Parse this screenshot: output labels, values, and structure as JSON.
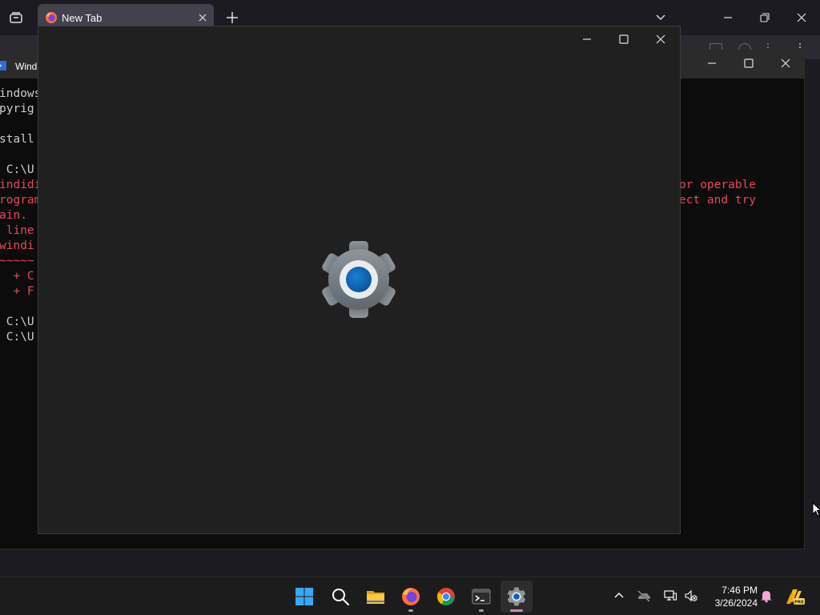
{
  "browser": {
    "tab_title": "New Tab",
    "favicon_icon": "firefox-icon"
  },
  "terminal": {
    "title": "Windows PowerShell",
    "title_visible": "Wind",
    "left_lines": [
      {
        "text": "indows",
        "color": "white"
      },
      {
        "text": "pyrig",
        "color": "white"
      },
      {
        "text": "",
        "color": "white"
      },
      {
        "text": "stall",
        "color": "white"
      },
      {
        "text": "",
        "color": "white"
      },
      {
        "text": " C:\\U",
        "color": "white"
      },
      {
        "text": "indidi",
        "color": "red"
      },
      {
        "text": "rogram",
        "color": "red"
      },
      {
        "text": "ain.",
        "color": "red"
      },
      {
        "text": " line",
        "color": "red"
      },
      {
        "text": "windi",
        "color": "red"
      },
      {
        "text": "~~~~~",
        "color": "red"
      },
      {
        "text": "  + C",
        "color": "red"
      },
      {
        "text": "  + F",
        "color": "red"
      },
      {
        "text": "",
        "color": "white"
      },
      {
        "text": " C:\\U",
        "color": "white"
      },
      {
        "text": " C:\\U",
        "color": "white"
      }
    ],
    "right_lines": [
      {
        "text": "or operable",
        "color": "red"
      },
      {
        "text": "ect and try",
        "color": "red"
      }
    ]
  },
  "settings": {
    "splash_icon": "settings-gear-icon"
  },
  "taskbar": {
    "apps": [
      {
        "name": "start-button",
        "icon": "windows-logo-icon",
        "active": false,
        "running": false
      },
      {
        "name": "search-button",
        "icon": "search-icon",
        "active": false,
        "running": false
      },
      {
        "name": "file-explorer-button",
        "icon": "folder-icon",
        "active": false,
        "running": false
      },
      {
        "name": "firefox-button",
        "icon": "firefox-icon",
        "active": false,
        "running": true
      },
      {
        "name": "chrome-button",
        "icon": "chrome-icon",
        "active": false,
        "running": false
      },
      {
        "name": "terminal-button",
        "icon": "terminal-icon",
        "active": false,
        "running": true
      },
      {
        "name": "settings-button",
        "icon": "gear-icon",
        "active": true,
        "running": true
      }
    ],
    "tray": {
      "chevron_icon": "chevron-up-icon",
      "onedrive_icon": "onedrive-icon",
      "network_icon": "network-icon",
      "volume_icon": "volume-muted-icon"
    },
    "clock": {
      "time": "7:46 PM",
      "date": "3/26/2024"
    },
    "notification_icon": "bell-icon",
    "copilot_icon": "copilot-icon",
    "copilot_badge": "PRE"
  },
  "colors": {
    "accent": "#0067c0",
    "terminal_red": "#e74856",
    "active_indicator": "#d381c3"
  }
}
